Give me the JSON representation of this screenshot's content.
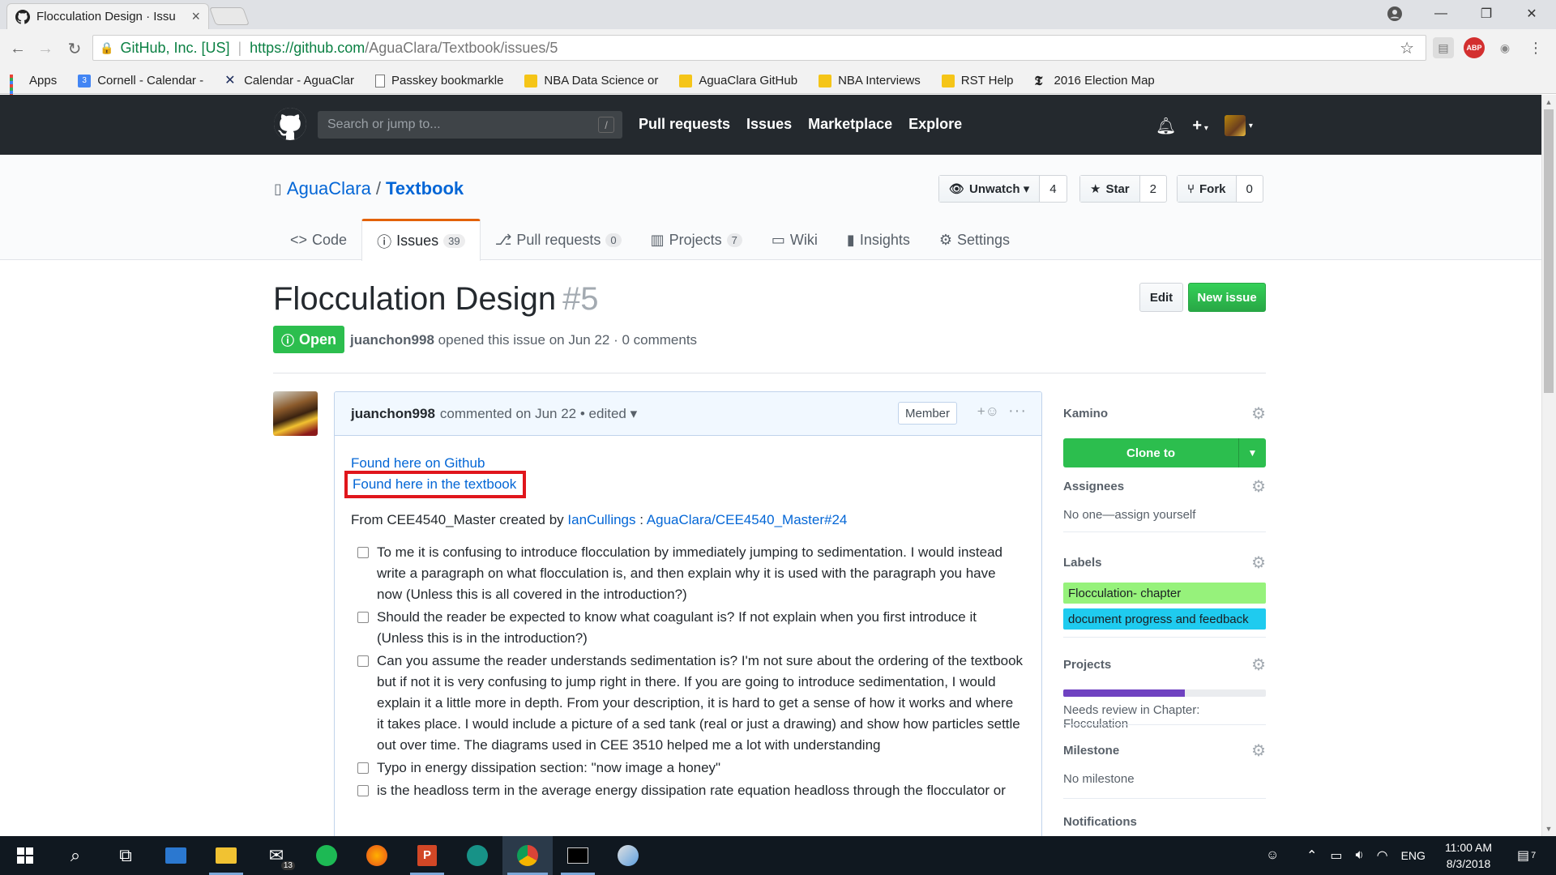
{
  "browser": {
    "tab_title": "Flocculation Design · Issu",
    "tab_close": "×",
    "window_controls": {
      "minimize": "—",
      "restore": "❐",
      "close": "✕"
    },
    "security_label": "GitHub, Inc. [US]",
    "url_host": "https://github.com",
    "url_path": "/AguaClara/Textbook/issues/5",
    "bookmarks": [
      {
        "label": "Apps",
        "icon": "apps-grid-icon"
      },
      {
        "label": "Cornell - Calendar -",
        "icon": "calendar-icon"
      },
      {
        "label": "Calendar - AguaClar",
        "icon": "x-logo-icon"
      },
      {
        "label": "Passkey bookmarkle",
        "icon": "page-icon"
      },
      {
        "label": "NBA Data Science or",
        "icon": "folder-icon"
      },
      {
        "label": "AguaClara GitHub",
        "icon": "folder-icon"
      },
      {
        "label": "NBA Interviews",
        "icon": "folder-icon"
      },
      {
        "label": "RST Help",
        "icon": "folder-icon"
      },
      {
        "label": "2016 Election Map",
        "icon": "nyt-icon"
      }
    ]
  },
  "github": {
    "search_placeholder": "Search or jump to...",
    "search_key": "/",
    "nav": [
      "Pull requests",
      "Issues",
      "Marketplace",
      "Explore"
    ],
    "repo_owner": "AguaClara",
    "repo_sep": "/",
    "repo_name": "Textbook",
    "actions": {
      "watch_label": "Unwatch ▾",
      "watch_count": "4",
      "star_label": "Star",
      "star_count": "2",
      "fork_label": "Fork",
      "fork_count": "0"
    },
    "tabs": {
      "code": "Code",
      "issues": "Issues",
      "issues_count": "39",
      "pulls": "Pull requests",
      "pulls_count": "0",
      "projects": "Projects",
      "projects_count": "7",
      "wiki": "Wiki",
      "insights": "Insights",
      "settings": "Settings"
    }
  },
  "issue": {
    "title": "Flocculation Design",
    "number": "#5",
    "edit_label": "Edit",
    "new_issue_label": "New issue",
    "state": "Open",
    "author": "juanchon998",
    "meta_text": "opened this issue on Jun 22 · 0 comments",
    "comment": {
      "author": "juanchon998",
      "meta": "commented on Jun 22 • edited ▾",
      "badge": "Member",
      "reaction": "+☺",
      "more": "···",
      "link_github": "Found here on Github",
      "link_textbook": "Found here in the textbook",
      "from_prefix": "From CEE4540_Master created by",
      "from_user": "IanCullings",
      "from_sep": ":",
      "from_ref": "AguaClara/CEE4540_Master#24",
      "tasks": [
        "To me it is confusing to introduce flocculation by immediately jumping to sedimentation. I would instead write a paragraph on what flocculation is, and then explain why it is used with the paragraph you have now (Unless this is all covered in the introduction?)",
        "Should the reader be expected to know what coagulant is? If not explain when you first introduce it (Unless this is in the introduction?)",
        "Can you assume the reader understands sedimentation is? I'm not sure about the ordering of the textbook but if not it is very confusing to jump right in there. If you are going to introduce sedimentation, I would explain it a little more in depth. From your description, it is hard to get a sense of how it works and where it takes place. I would include a picture of a sed tank (real or just a drawing) and show how particles settle out over time. The diagrams used in CEE 3510 helped me a lot with understanding",
        "Typo in energy dissipation section: \"now image a honey\"",
        "is the headloss term in the average energy dissipation rate equation headloss through the flocculator or"
      ]
    }
  },
  "sidebar": {
    "kamino": "Kamino",
    "clone_label": "Clone to",
    "assignees": "Assignees",
    "assignees_value": "No one—assign yourself",
    "labels": "Labels",
    "label_items": [
      {
        "name": "Flocculation- chapter",
        "color": "#96f27b"
      },
      {
        "name": "document progress and feedback",
        "color": "#1fcbef"
      }
    ],
    "projects": "Projects",
    "project_progress": 0.6,
    "project_status": "Needs review in Chapter: Flocculation",
    "milestone": "Milestone",
    "milestone_value": "No milestone",
    "notifications": "Notifications"
  },
  "taskbar": {
    "mail_badge": "13",
    "language": "ENG",
    "time": "11:00 AM",
    "date": "8/3/2018",
    "notification_count": "7"
  },
  "colors": {
    "gh_header": "#24292e",
    "link": "#0366d6",
    "open_green": "#2cbe4e",
    "highlight_box": "#e0161c",
    "issues_tab_accent": "#e36209"
  }
}
